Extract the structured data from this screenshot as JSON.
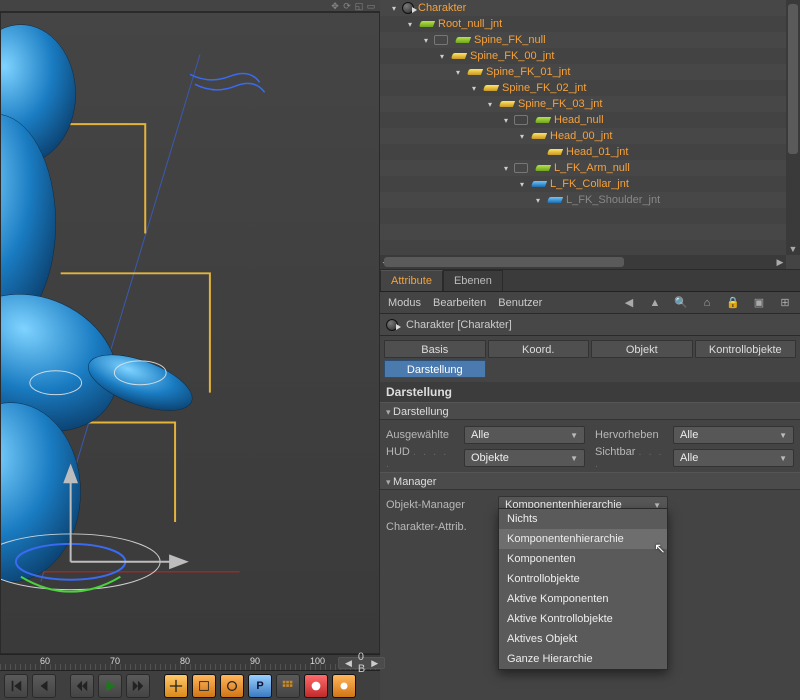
{
  "viewport_toolbar": [
    "move",
    "rotate",
    "scale",
    "frame"
  ],
  "ruler": {
    "ticks": [
      "60",
      "70",
      "80",
      "90",
      "100"
    ],
    "display": "0 B"
  },
  "bottom_tools": [
    "first",
    "prev-key",
    "prev",
    "play",
    "loop",
    "next",
    "next-key",
    "last",
    "sep",
    "axis",
    "snap",
    "circle",
    "park",
    "grid",
    "tiny",
    "red",
    "orange"
  ],
  "tree": [
    {
      "indent": 0,
      "twist": "▾",
      "kind": "node",
      "label": "Charakter"
    },
    {
      "indent": 1,
      "twist": "▾",
      "kind": "bone-g",
      "label": "Root_null_jnt"
    },
    {
      "indent": 2,
      "twist": "▾",
      "lz": true,
      "kind": "bone-g",
      "label": "Spine_FK_null"
    },
    {
      "indent": 3,
      "twist": "▾",
      "kind": "bone-y",
      "label": "Spine_FK_00_jnt"
    },
    {
      "indent": 4,
      "twist": "▾",
      "kind": "bone-y",
      "label": "Spine_FK_01_jnt"
    },
    {
      "indent": 5,
      "twist": "▾",
      "kind": "bone-y",
      "label": "Spine_FK_02_jnt"
    },
    {
      "indent": 6,
      "twist": "▾",
      "kind": "bone-y",
      "label": "Spine_FK_03_jnt"
    },
    {
      "indent": 7,
      "twist": "▾",
      "lz": true,
      "kind": "bone-g",
      "label": "Head_null"
    },
    {
      "indent": 8,
      "twist": "▾",
      "kind": "bone-y",
      "label": "Head_00_jnt"
    },
    {
      "indent": 9,
      "twist": "",
      "kind": "bone-y",
      "label": "Head_01_jnt"
    },
    {
      "indent": 7,
      "twist": "▾",
      "lz": true,
      "kind": "bone-g",
      "label": "L_FK_Arm_null"
    },
    {
      "indent": 8,
      "twist": "▾",
      "kind": "bone-b",
      "label": "L_FK_Collar_jnt"
    },
    {
      "indent": 9,
      "twist": "▾",
      "kind": "bone-b",
      "label": "L_FK_Shoulder_jnt",
      "dim": true
    }
  ],
  "tabs": {
    "attribute": "Attribute",
    "ebenen": "Ebenen"
  },
  "menubar": {
    "modus": "Modus",
    "bearbeiten": "Bearbeiten",
    "benutzer": "Benutzer"
  },
  "obj_header": "Charakter [Charakter]",
  "mode_tabs": {
    "basis": "Basis",
    "koord": "Koord.",
    "objekt": "Objekt",
    "kontroll": "Kontrollobjekte",
    "darstellung": "Darstellung"
  },
  "section": {
    "title": "Darstellung",
    "hdr_darstellung": "Darstellung",
    "hdr_manager": "Manager"
  },
  "darstellung": {
    "ausgewaehlte_label": "Ausgewählte",
    "ausgewaehlte_value": "Alle",
    "hud_label": "HUD",
    "hud_value": "Objekte",
    "hervorheben_label": "Hervorheben",
    "hervorheben_value": "Alle",
    "sichtbar_label": "Sichtbar",
    "sichtbar_value": "Alle"
  },
  "manager": {
    "objmgr_label": "Objekt-Manager",
    "objmgr_value": "Komponentenhierarchie",
    "charattr_label": "Charakter-Attrib."
  },
  "dropdown": {
    "items": [
      "Nichts",
      "Komponentenhierarchie",
      "Komponenten",
      "Kontrollobjekte",
      "Aktive Komponenten",
      "Aktive Kontrollobjekte",
      "Aktives Objekt",
      "Ganze Hierarchie"
    ],
    "highlight": 1
  }
}
